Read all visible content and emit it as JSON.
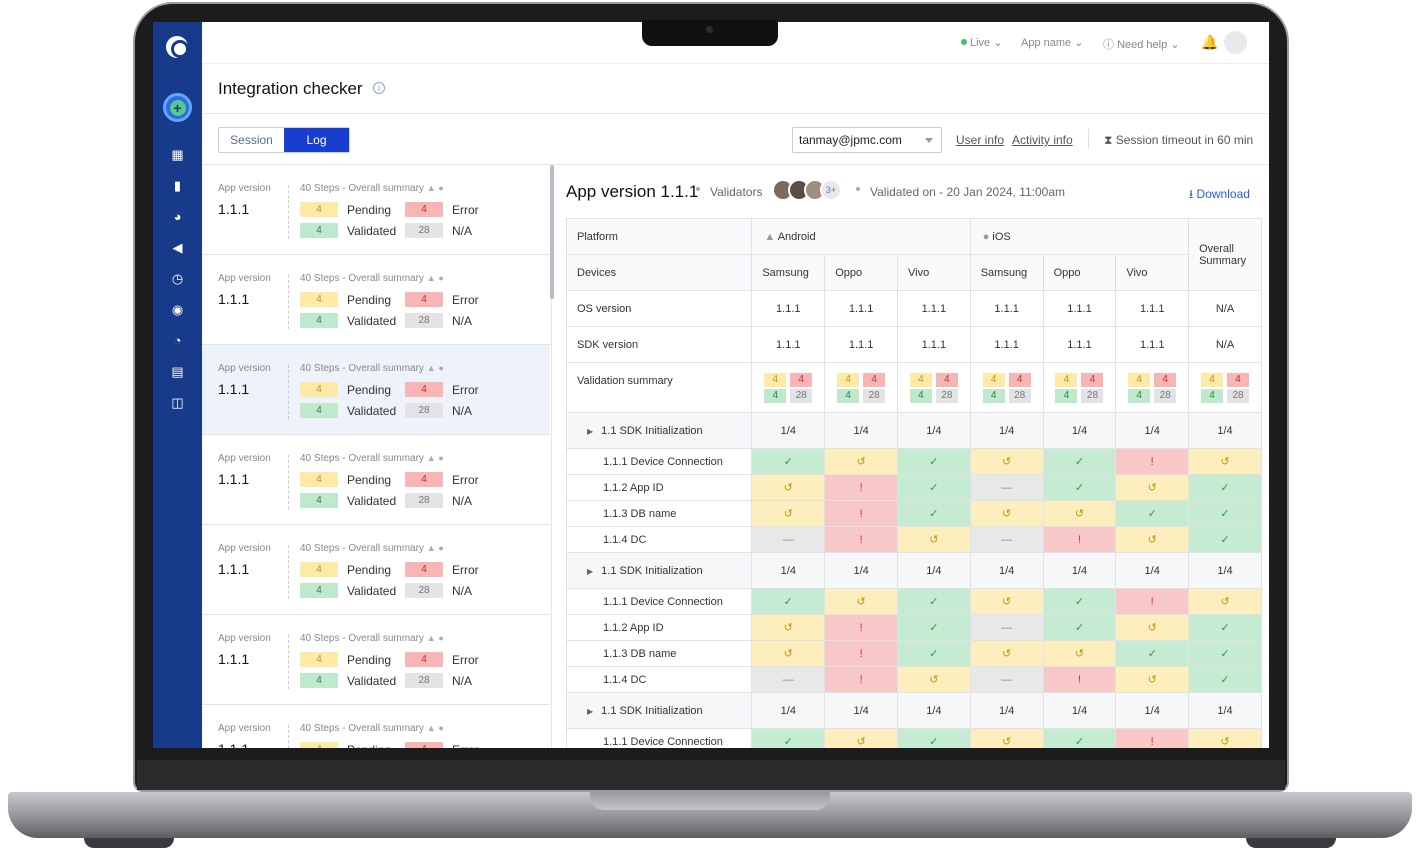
{
  "topbar": {
    "live": "Live",
    "app_name": "App name",
    "help": "Need help"
  },
  "page": {
    "title": "Integration checker"
  },
  "tabs": {
    "session": "Session",
    "log": "Log"
  },
  "account": {
    "email": "tanmay@jpmc.com",
    "user_info": "User info",
    "activity_info": "Activity info",
    "timeout": "Session timeout in 60 min"
  },
  "list_card": {
    "app_version_label": "App version",
    "version": "1.1.1",
    "steps": "40 Steps - Overall summary",
    "pending_count": "4",
    "pending_label": "Pending",
    "error_count": "4",
    "error_label": "Error",
    "validated_count": "4",
    "validated_label": "Validated",
    "na_count": "28",
    "na_label": "N/A"
  },
  "detail": {
    "title": "App version 1.1.1",
    "validators_label": "Validators",
    "validators_more": "3+",
    "validated_on": "Validated on - 20 Jan 2024, 11:00am",
    "download": "Download"
  },
  "table": {
    "platform_label": "Platform",
    "devices_label": "Devices",
    "android": "Android",
    "ios": "iOS",
    "overall": "Overall Summary",
    "devices": [
      "Samsung",
      "Oppo",
      "Vivo",
      "Samsung",
      "Oppo",
      "Vivo"
    ],
    "os_version_label": "OS version",
    "os_versions": [
      "1.1.1",
      "1.1.1",
      "1.1.1",
      "1.1.1",
      "1.1.1",
      "1.1.1",
      "N/A"
    ],
    "sdk_version_label": "SDK version",
    "sdk_versions": [
      "1.1.1",
      "1.1.1",
      "1.1.1",
      "1.1.1",
      "1.1.1",
      "1.1.1",
      "N/A"
    ],
    "validation_summary_label": "Validation summary",
    "group_label": "1.1  SDK Initialization",
    "group_values": [
      "1/4",
      "1/4",
      "1/4",
      "1/4",
      "1/4",
      "1/4",
      "1/4"
    ],
    "rows": [
      {
        "label": "1.1.1  Device Connection",
        "cells": [
          "g",
          "y",
          "g",
          "y",
          "g",
          "r",
          "y"
        ]
      },
      {
        "label": "1.1.2  App ID",
        "cells": [
          "y",
          "r",
          "g",
          "n",
          "g",
          "y",
          "g"
        ]
      },
      {
        "label": "1.1.3  DB name",
        "cells": [
          "y",
          "r",
          "g",
          "y",
          "y",
          "g",
          "g"
        ]
      },
      {
        "label": "1.1.4  DC",
        "cells": [
          "n",
          "r",
          "y",
          "n",
          "r",
          "y",
          "g"
        ]
      }
    ]
  },
  "icons": {
    "g": "check-icon",
    "y": "history-icon",
    "r": "exclamation-icon",
    "n": "dash-icon"
  }
}
